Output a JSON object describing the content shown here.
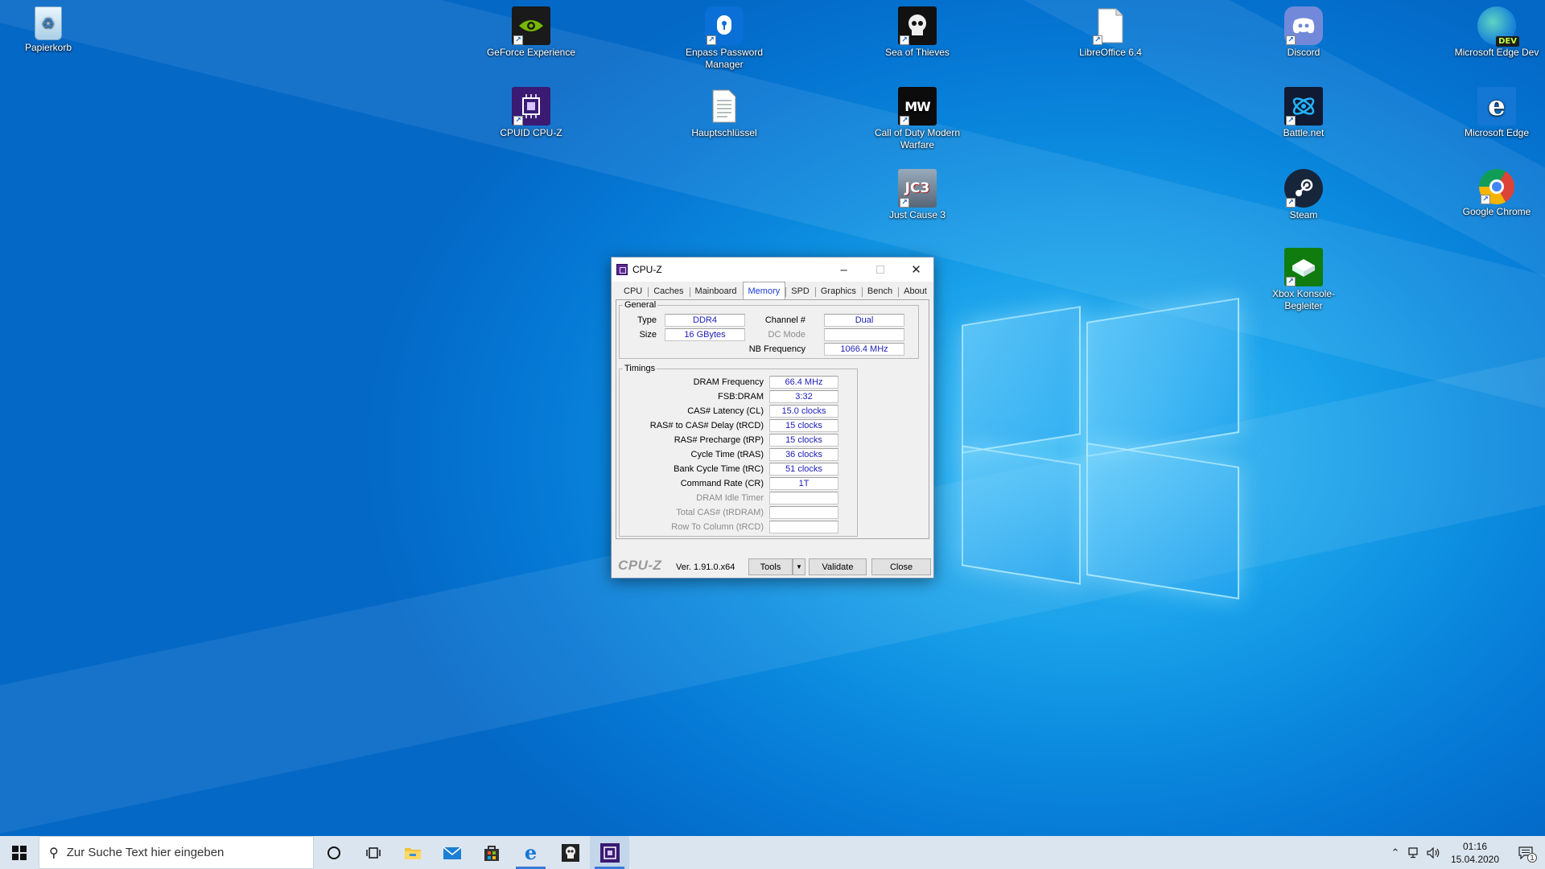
{
  "desktop": {
    "icons": [
      {
        "label": "Papierkorb",
        "icon": "recycle-bin-icon"
      },
      {
        "label": "GeForce Experience",
        "icon": "nvidia-icon"
      },
      {
        "label": "Enpass Password Manager",
        "icon": "enpass-icon"
      },
      {
        "label": "Sea of Thieves",
        "icon": "skull-icon"
      },
      {
        "label": "LibreOffice 6.4",
        "icon": "libreoffice-icon"
      },
      {
        "label": "Discord",
        "icon": "discord-icon"
      },
      {
        "label": "Microsoft Edge Dev",
        "icon": "edge-dev-icon"
      },
      {
        "label": "CPUID CPU-Z",
        "icon": "cpuz-icon"
      },
      {
        "label": "Hauptschlüssel",
        "icon": "text-document-icon"
      },
      {
        "label": "Call of Duty Modern Warfare",
        "icon": "mw-icon"
      },
      {
        "label": "Battle.net",
        "icon": "battlenet-icon"
      },
      {
        "label": "Microsoft Edge",
        "icon": "edge-icon"
      },
      {
        "label": "Just Cause 3",
        "icon": "jc3-icon"
      },
      {
        "label": "Steam",
        "icon": "steam-icon"
      },
      {
        "label": "Google Chrome",
        "icon": "chrome-icon"
      },
      {
        "label": "Xbox Konsole-Begleiter",
        "icon": "xbox-icon"
      }
    ],
    "badge_mw": "MW",
    "badge_jc3": "JC3",
    "badge_dev": "DEV",
    "badge_edge": "e"
  },
  "window": {
    "title": "CPU-Z",
    "tabs": [
      {
        "label": "CPU"
      },
      {
        "label": "Caches"
      },
      {
        "label": "Mainboard"
      },
      {
        "label": "Memory",
        "active": true
      },
      {
        "label": "SPD"
      },
      {
        "label": "Graphics"
      },
      {
        "label": "Bench"
      },
      {
        "label": "About"
      }
    ],
    "general": {
      "legend": "General",
      "type_label": "Type",
      "type_value": "DDR4",
      "size_label": "Size",
      "size_value": "16 GBytes",
      "channel_label": "Channel #",
      "channel_value": "Dual",
      "dcmode_label": "DC Mode",
      "dcmode_value": "",
      "nbfreq_label": "NB Frequency",
      "nbfreq_value": "1066.4 MHz"
    },
    "timings": {
      "legend": "Timings",
      "rows": [
        {
          "label": "DRAM Frequency",
          "value": "66.4 MHz",
          "enabled": true
        },
        {
          "label": "FSB:DRAM",
          "value": "3:32",
          "enabled": true
        },
        {
          "label": "CAS# Latency (CL)",
          "value": "15.0 clocks",
          "enabled": true
        },
        {
          "label": "RAS# to CAS# Delay (tRCD)",
          "value": "15 clocks",
          "enabled": true
        },
        {
          "label": "RAS# Precharge (tRP)",
          "value": "15 clocks",
          "enabled": true
        },
        {
          "label": "Cycle Time (tRAS)",
          "value": "36 clocks",
          "enabled": true
        },
        {
          "label": "Bank Cycle Time (tRC)",
          "value": "51 clocks",
          "enabled": true
        },
        {
          "label": "Command Rate (CR)",
          "value": "1T",
          "enabled": true
        },
        {
          "label": "DRAM Idle Timer",
          "value": "",
          "enabled": false
        },
        {
          "label": "Total CAS# (tRDRAM)",
          "value": "",
          "enabled": false
        },
        {
          "label": "Row To Column (tRCD)",
          "value": "",
          "enabled": false
        }
      ]
    },
    "footer": {
      "brand": "CPU-Z",
      "version": "Ver. 1.91.0.x64",
      "tools_label": "Tools",
      "validate_label": "Validate",
      "close_label": "Close"
    }
  },
  "taskbar": {
    "search_placeholder": "Zur Suche Text hier eingeben",
    "time": "01:16",
    "date": "15.04.2020",
    "notification_count": "1"
  },
  "colors": {
    "accent": "#1a3ad8",
    "value_text": "#1c1cb8",
    "desktop_blue": "#0a88dd",
    "taskbar": "#dbe5ef"
  }
}
